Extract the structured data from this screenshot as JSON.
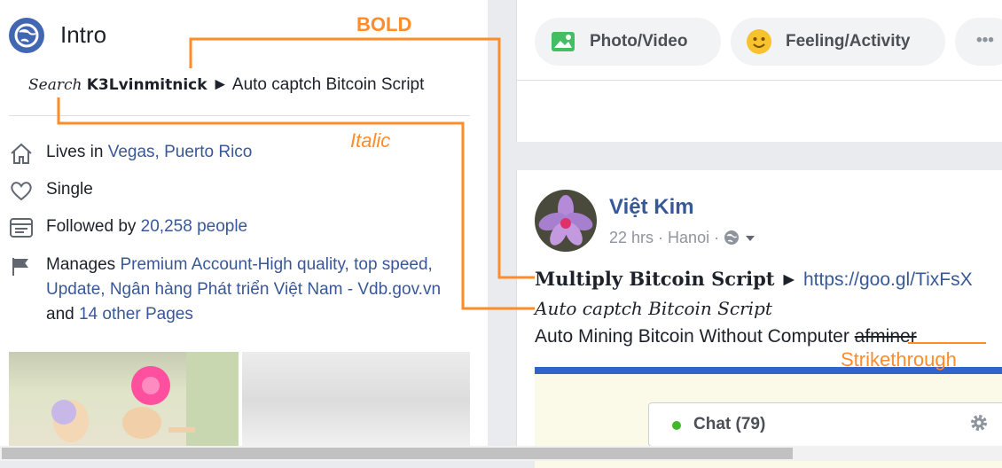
{
  "intro": {
    "title": "Intro",
    "search_prefix": "Search",
    "search_bold": "K3Lvinmitnick",
    "search_arrow": " ► ",
    "search_rest": "Auto captch Bitcoin Script"
  },
  "about": {
    "lives_prefix": "Lives in ",
    "lives_place": "Vegas, Puerto Rico",
    "relationship": "Single",
    "followed_prefix": "Followed by ",
    "followers": "20,258 people",
    "manages_prefix": "Manages ",
    "manages_pages": "Premium Account-High quality, top speed, Update, Ngân hàng Phát triển Việt Nam - Vdb.gov.vn",
    "manages_and": " and ",
    "manages_more": "14 other Pages"
  },
  "composer": {
    "photo_label": "Photo/Video",
    "feeling_label": "Feeling/Activity",
    "more_label": "•••"
  },
  "post": {
    "author": "Việt Kim",
    "time": "22 hrs",
    "location": "Hanoi",
    "line1_bold": "Multiply Bitcoin Script",
    "line1_arrow": " ► ",
    "line1_link": "https://goo.gl/TixFsX",
    "line2_italic": "Auto captch Bitcoin Script",
    "line3_text": "Auto Mining Bitcoin Without Computer ",
    "line3_strike": "afminer"
  },
  "chat": {
    "label": "Chat (79)"
  },
  "annotations": {
    "bold": "BOLD",
    "italic": "Italic",
    "strikethrough": "Strikethrough",
    "color": "#ff8c2a"
  },
  "icons": [
    "globe-icon",
    "home-icon",
    "heart-icon",
    "followers-icon",
    "flag-icon",
    "photo-icon",
    "smiley-icon",
    "globe-audience-icon",
    "caret-down-icon",
    "gear-icon"
  ]
}
